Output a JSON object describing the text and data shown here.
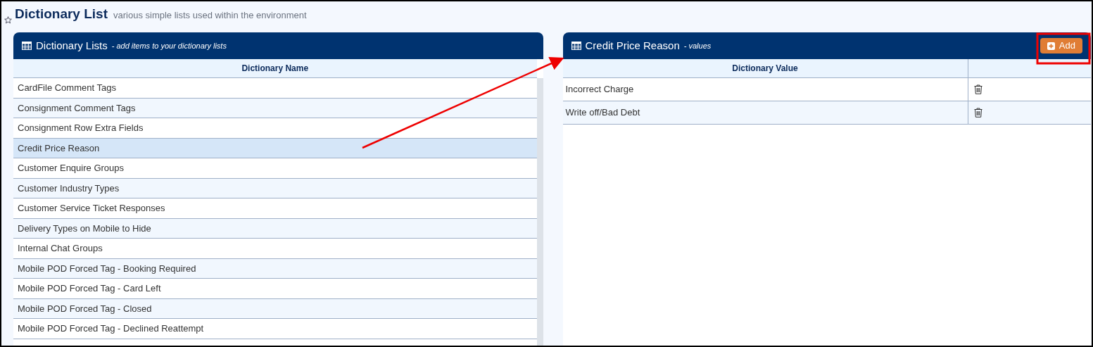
{
  "page": {
    "title": "Dictionary List",
    "subtitle": "various simple lists used within the environment"
  },
  "lists_panel": {
    "title": "Dictionary Lists",
    "subtitle": "- add items to your dictionary lists",
    "column": "Dictionary Name",
    "rows": [
      {
        "name": "CardFile Comment Tags",
        "selected": false
      },
      {
        "name": "Consignment Comment Tags",
        "selected": false
      },
      {
        "name": "Consignment Row Extra Fields",
        "selected": false
      },
      {
        "name": "Credit Price Reason",
        "selected": true
      },
      {
        "name": "Customer Enquire Groups",
        "selected": false
      },
      {
        "name": "Customer Industry Types",
        "selected": false
      },
      {
        "name": "Customer Service Ticket Responses",
        "selected": false
      },
      {
        "name": "Delivery Types on Mobile to Hide",
        "selected": false
      },
      {
        "name": "Internal Chat Groups",
        "selected": false
      },
      {
        "name": "Mobile POD Forced Tag - Booking Required",
        "selected": false
      },
      {
        "name": "Mobile POD Forced Tag - Card Left",
        "selected": false
      },
      {
        "name": "Mobile POD Forced Tag - Closed",
        "selected": false
      },
      {
        "name": "Mobile POD Forced Tag - Declined Reattempt",
        "selected": false
      }
    ]
  },
  "values_panel": {
    "title": "Credit Price Reason",
    "subtitle": "- values",
    "add_button": "Add",
    "column": "Dictionary Value",
    "rows": [
      {
        "value": "Incorrect Charge"
      },
      {
        "value": "Write off/Bad Debt"
      }
    ]
  }
}
